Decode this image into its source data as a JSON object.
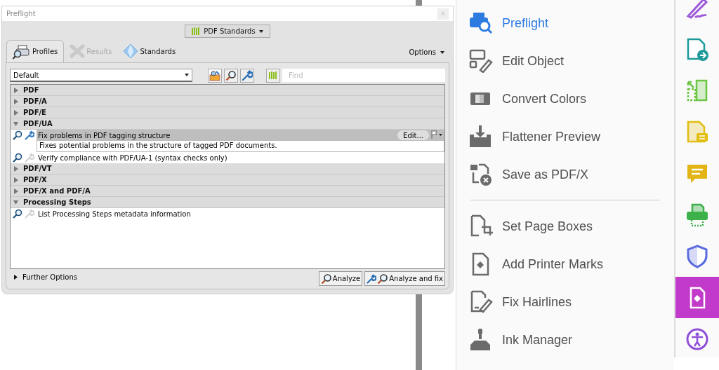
{
  "dialog": {
    "title": "Preflight",
    "close": "×",
    "library_button": "PDF Standards",
    "tabs": [
      {
        "label": "Profiles",
        "selected": true,
        "disabled": false
      },
      {
        "label": "Results",
        "selected": false,
        "disabled": true
      },
      {
        "label": "Standards",
        "selected": false,
        "disabled": false
      }
    ],
    "options_label": "Options",
    "profile_select": "Default",
    "find": {
      "placeholder": "Find"
    },
    "groups": [
      {
        "label": "PDF",
        "expanded": false
      },
      {
        "label": "PDF/A",
        "expanded": false
      },
      {
        "label": "PDF/E",
        "expanded": false
      },
      {
        "label": "PDF/UA",
        "expanded": true,
        "profiles": [
          {
            "label": "Fix problems in PDF tagging structure",
            "selected": true,
            "fixups": true,
            "description": "Fixes potential problems in the structure of tagged PDF documents.",
            "edit": "Edit..."
          },
          {
            "label": "Verify compliance with PDF/UA-1 (syntax checks only)",
            "selected": false,
            "fixups": false
          }
        ]
      },
      {
        "label": "PDF/VT",
        "expanded": false
      },
      {
        "label": "PDF/X",
        "expanded": false
      },
      {
        "label": "PDF/X and PDF/A",
        "expanded": false
      },
      {
        "label": "Processing Steps",
        "expanded": true,
        "profiles": [
          {
            "label": "List Processing Steps metadata information",
            "selected": false,
            "fixups": false
          }
        ]
      }
    ],
    "further_options": "Further Options",
    "buttons": [
      "Analyze",
      "Analyze and fix"
    ]
  },
  "tools": [
    [
      {
        "label": "Preflight",
        "selected": true
      },
      {
        "label": "Edit Object",
        "selected": false
      },
      {
        "label": "Convert Colors",
        "selected": false
      },
      {
        "label": "Flattener Preview",
        "selected": false
      },
      {
        "label": "Save as PDF/X",
        "selected": false
      }
    ],
    [
      {
        "label": "Set Page Boxes",
        "selected": false
      },
      {
        "label": "Add Printer Marks",
        "selected": false
      },
      {
        "label": "Fix Hairlines",
        "selected": false
      },
      {
        "label": "Ink Manager",
        "selected": false
      }
    ]
  ],
  "rail": [
    {
      "color": "#9b5ad8",
      "selected": false
    },
    {
      "color": "#1f9a9a",
      "selected": false
    },
    {
      "color": "#6cc644",
      "selected": false
    },
    {
      "color": "#e2bd12",
      "selected": false
    },
    {
      "color": "#e2b416",
      "selected": false
    },
    {
      "color": "#3cb14a",
      "selected": false
    },
    {
      "color": "#5b6be0",
      "selected": false
    },
    {
      "color": "#c23ac9",
      "selected": true
    },
    {
      "color": "#8f4fd8",
      "selected": false
    }
  ]
}
